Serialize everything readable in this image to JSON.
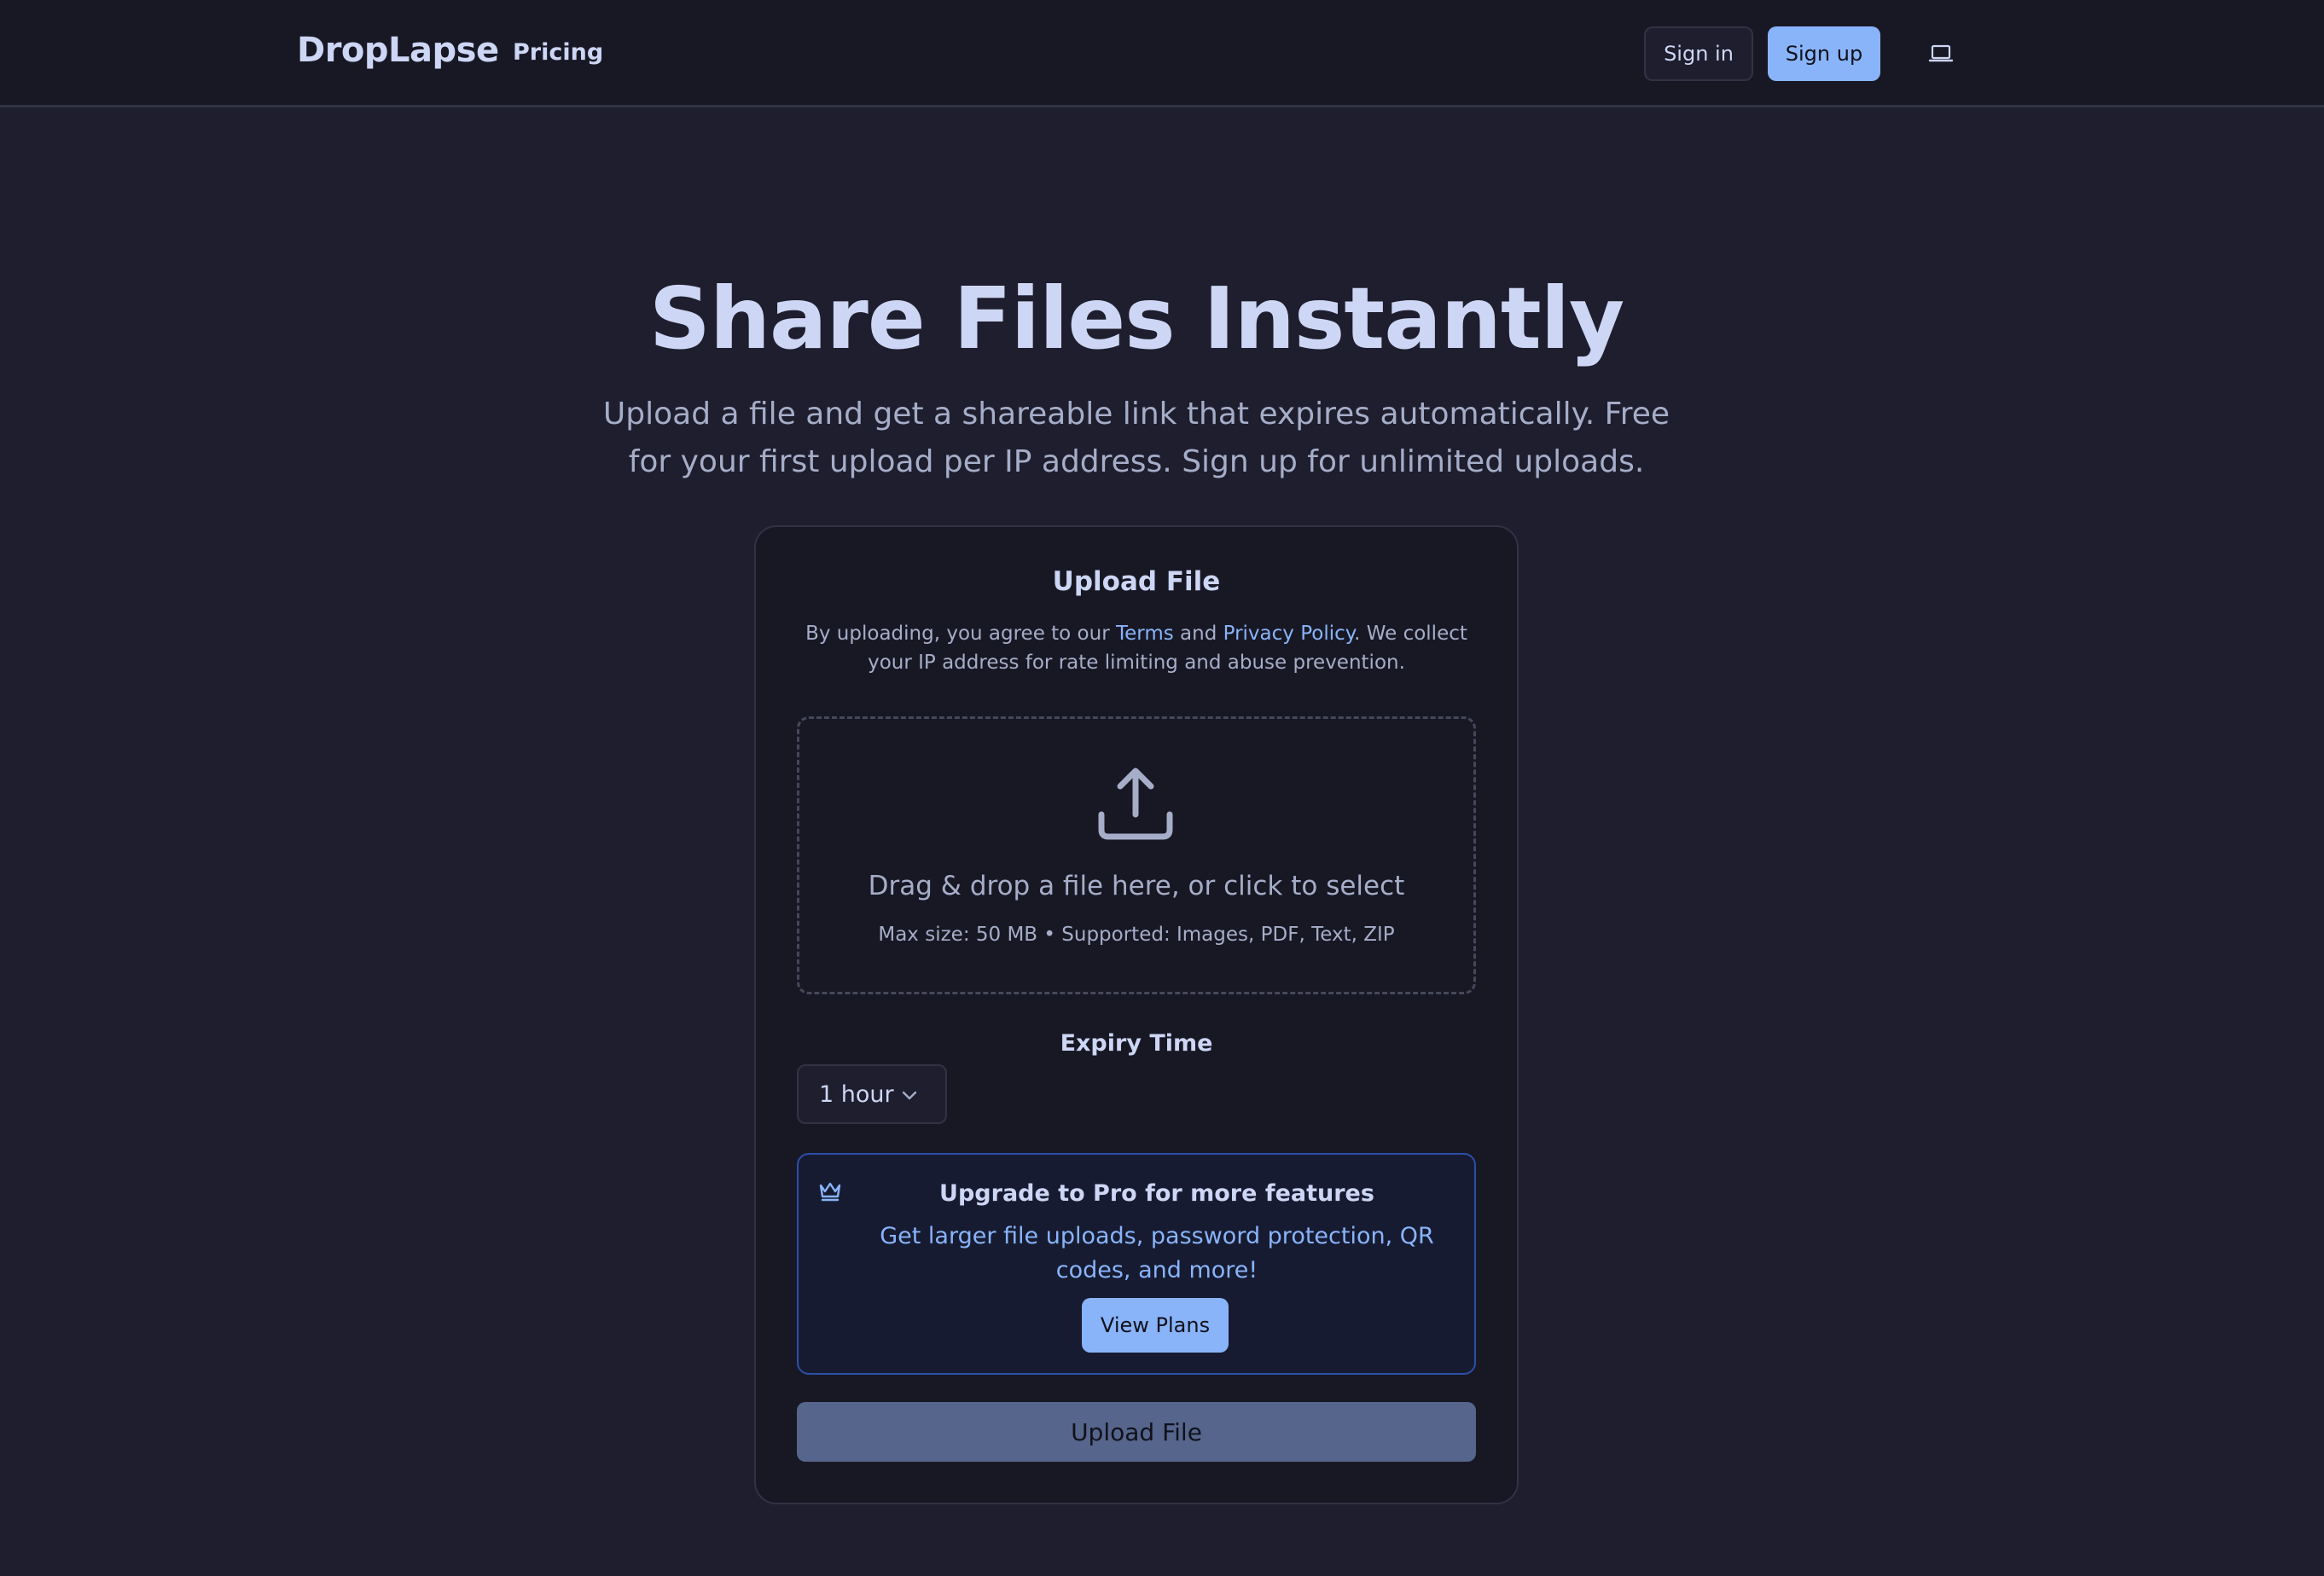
{
  "nav": {
    "brand": "DropLapse",
    "pricing_label": "Pricing",
    "signin_label": "Sign in",
    "signup_label": "Sign up",
    "theme_icon": "laptop-icon"
  },
  "hero": {
    "title": "Share Files Instantly",
    "subtitle": "Upload a file and get a shareable link that expires automatically. Free for your first upload per IP address. Sign up for unlimited uploads."
  },
  "upload_card": {
    "title": "Upload File",
    "terms": {
      "prefix": "By uploading, you agree to our ",
      "terms_link": "Terms",
      "and": " and ",
      "privacy_link": "Privacy Policy",
      "suffix": ". We collect your IP address for rate limiting and abuse prevention."
    },
    "dropzone": {
      "icon": "upload-icon",
      "main_text": "Drag & drop a file here, or click to select",
      "sub_text": "Max size: 50 MB • Supported: Images, PDF, Text, ZIP"
    },
    "expiry": {
      "label": "Expiry Time",
      "selected": "1 hour"
    },
    "promo": {
      "icon": "crown-icon",
      "title": "Upgrade to Pro for more features",
      "body": "Get larger file uploads, password protection, QR codes, and more!",
      "button_label": "View Plans"
    },
    "submit_label": "Upload File"
  },
  "colors": {
    "background": "#1e1e2e",
    "navbar": "#181825",
    "accent": "#89b4fa",
    "text": "#cdd6f4",
    "muted_text": "#a6adc8",
    "upload_button_disabled": "#56658c"
  }
}
